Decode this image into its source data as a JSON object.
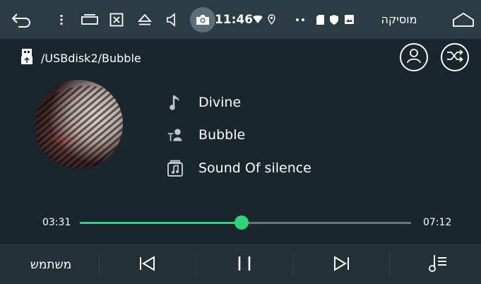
{
  "statusbar": {
    "time": "11:46",
    "title": "מוסיקה",
    "icons": [
      "back-arrow-icon",
      "more-vert-icon",
      "recent-apps-icon",
      "close-box-icon",
      "eject-icon",
      "volume-icon",
      "camera-icon",
      "wifi-icon",
      "location-icon",
      "more-dots-icon",
      "sd-card-icon",
      "shield-icon",
      "image-icon",
      "home-icon"
    ]
  },
  "path": {
    "text": "/USBdisk2/Bubble",
    "icon": "usb-drive-icon"
  },
  "actions": {
    "account_icon": "person-icon",
    "shuffle_icon": "shuffle-icon"
  },
  "track": {
    "title": "Divine",
    "artist": "Bubble",
    "album": "Sound Of silence",
    "title_icon": "music-note-icon",
    "artist_icon": "artist-icon",
    "album_icon": "album-icon",
    "art_text": "slapdjack",
    "art_subtext": "BUBBLE"
  },
  "progress": {
    "elapsed": "03:31",
    "total": "07:12",
    "fraction": 0.489,
    "color": "#2ed478"
  },
  "bottombar": {
    "user_label": "משתמש",
    "icons": [
      "previous-icon",
      "pause-icon",
      "next-icon",
      "playlist-icon"
    ]
  }
}
